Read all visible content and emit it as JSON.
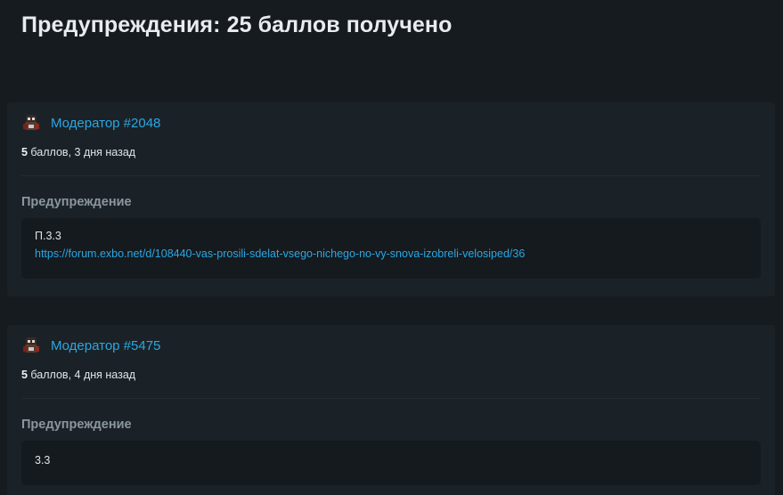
{
  "page": {
    "title": "Предупреждения: 25 баллов получено"
  },
  "warnings": [
    {
      "moderator": "Модератор #2048",
      "points": "5",
      "points_suffix": " баллов, 3 дня назад",
      "section_label": "Предупреждение",
      "text": "П.3.3",
      "link": "https://forum.exbo.net/d/108440-vas-prosili-sdelat-vsego-nichego-no-vy-snova-izobreli-velosiped/36"
    },
    {
      "moderator": "Модератор #5475",
      "points": "5",
      "points_suffix": " баллов, 4 дня назад",
      "section_label": "Предупреждение",
      "text": "3.3"
    }
  ],
  "colors": {
    "background": "#161b20",
    "card": "#1b2227",
    "content_box": "#151a1e",
    "link": "#2aa7e4",
    "label": "#8a979f"
  },
  "icons": {
    "avatar": "moderator-avatar-icon"
  }
}
